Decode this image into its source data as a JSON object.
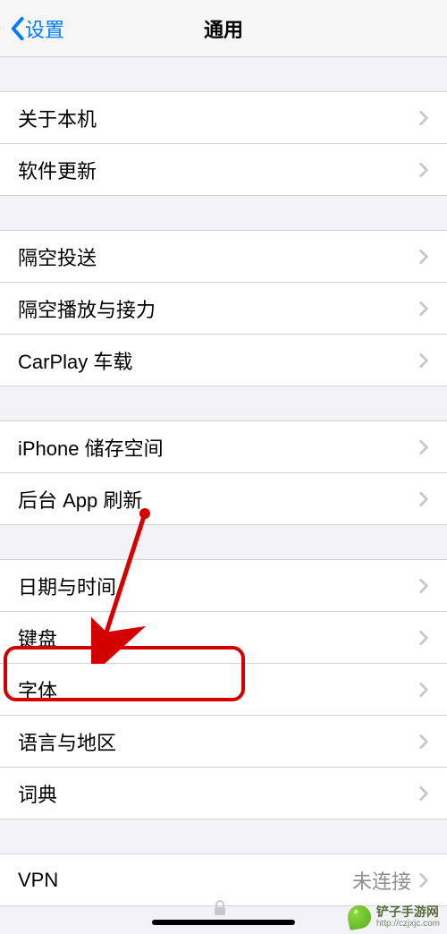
{
  "nav": {
    "back": "设置",
    "title": "通用"
  },
  "groups": [
    {
      "items": [
        {
          "id": "about",
          "label": "关于本机"
        },
        {
          "id": "software-update",
          "label": "软件更新"
        }
      ]
    },
    {
      "items": [
        {
          "id": "airdrop",
          "label": "隔空投送"
        },
        {
          "id": "airplay-handoff",
          "label": "隔空播放与接力"
        },
        {
          "id": "carplay",
          "label": "CarPlay 车载"
        }
      ]
    },
    {
      "items": [
        {
          "id": "iphone-storage",
          "label": "iPhone 储存空间"
        },
        {
          "id": "background-app-refresh",
          "label": "后台 App 刷新"
        }
      ]
    },
    {
      "items": [
        {
          "id": "date-time",
          "label": "日期与时间"
        },
        {
          "id": "keyboard",
          "label": "键盘"
        },
        {
          "id": "fonts",
          "label": "字体"
        },
        {
          "id": "language-region",
          "label": "语言与地区"
        },
        {
          "id": "dictionary",
          "label": "词典"
        }
      ]
    },
    {
      "items": [
        {
          "id": "vpn",
          "label": "VPN",
          "value": "未连接"
        }
      ]
    }
  ],
  "watermark": {
    "name": "铲子手游网",
    "url": "http://czjxjc.com"
  }
}
